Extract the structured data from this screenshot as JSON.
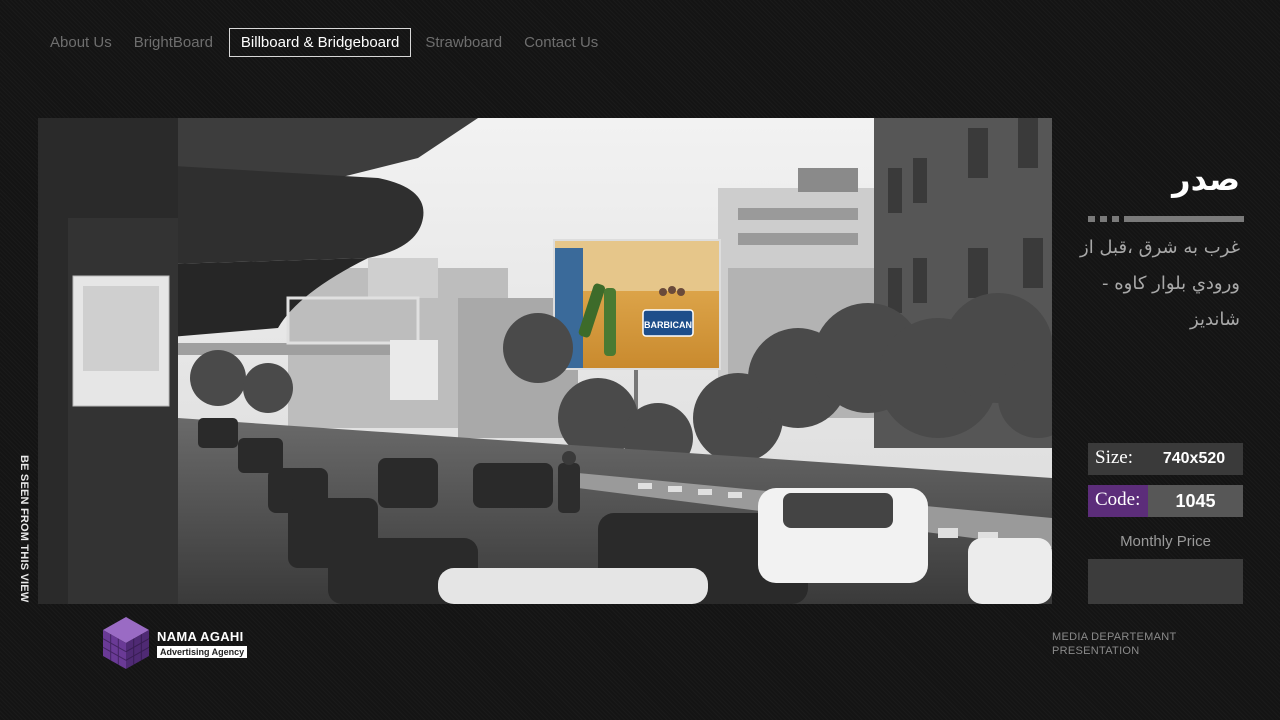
{
  "nav": {
    "items": [
      {
        "label": "About Us",
        "active": false
      },
      {
        "label": "BrightBoard",
        "active": false
      },
      {
        "label": "Billboard & Bridgeboard",
        "active": true
      },
      {
        "label": "Strawboard",
        "active": false
      },
      {
        "label": "Contact Us",
        "active": false
      }
    ]
  },
  "side_caption": "BE SEEN FROM THIS VIEW",
  "billboard_ad": {
    "brand": "BARBICAN"
  },
  "location": {
    "title": "صدر",
    "description": "غرب به شرق ،قبل از ورودي بلوار كاوه - شانديز"
  },
  "specs": {
    "size_label": "Size:",
    "size_value": "740x520",
    "code_label": "Code:",
    "code_value": "1045",
    "price_label": "Monthly Price",
    "price_value": ""
  },
  "footer": {
    "logo_name": "NAMA AGAHI",
    "logo_tagline": "Advertising Agency",
    "dept_line1": "MEDIA DEPARTEMANT",
    "dept_line2": "PRESENTATION"
  },
  "colors": {
    "accent_purple": "#5c2d7a",
    "background": "#141414",
    "panel_gray": "#3a3a3a"
  }
}
